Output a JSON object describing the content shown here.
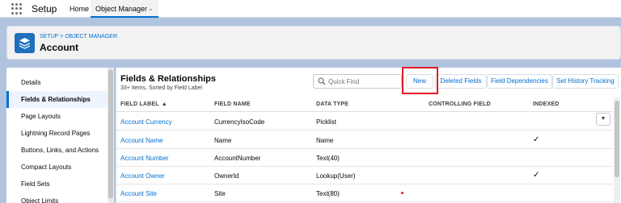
{
  "app": {
    "name": "Setup"
  },
  "nav": {
    "home": "Home",
    "object_manager": "Object Manager"
  },
  "header": {
    "breadcrumb": "SETUP > OBJECT MANAGER",
    "title": "Account"
  },
  "sidebar": {
    "items": [
      {
        "label": "Details",
        "active": false
      },
      {
        "label": "Fields & Relationships",
        "active": true
      },
      {
        "label": "Page Layouts",
        "active": false
      },
      {
        "label": "Lightning Record Pages",
        "active": false
      },
      {
        "label": "Buttons, Links, and Actions",
        "active": false
      },
      {
        "label": "Compact Layouts",
        "active": false
      },
      {
        "label": "Field Sets",
        "active": false
      },
      {
        "label": "Object Limits",
        "active": false
      }
    ]
  },
  "section": {
    "title": "Fields & Relationships",
    "subtitle": "33+ Items, Sorted by Field Label",
    "search_placeholder": "Quick Find",
    "buttons": {
      "new": "New",
      "deleted": "Deleted Fields",
      "dependencies": "Field Dependencies",
      "history": "Set History Tracking"
    }
  },
  "table": {
    "headers": {
      "label": "FIELD LABEL",
      "name": "FIELD NAME",
      "type": "DATA TYPE",
      "controlling": "CONTROLLING FIELD",
      "indexed": "INDEXED"
    },
    "sort_indicator": "▲",
    "rows": [
      {
        "label": "Account Currency",
        "name": "CurrencyIsoCode",
        "type": "Picklist",
        "indexed": ""
      },
      {
        "label": "Account Name",
        "name": "Name",
        "type": "Name",
        "indexed": "✓"
      },
      {
        "label": "Account Number",
        "name": "AccountNumber",
        "type": "Text(40)",
        "indexed": ""
      },
      {
        "label": "Account Owner",
        "name": "OwnerId",
        "type": "Lookup(User)",
        "indexed": "✓"
      },
      {
        "label": "Account Site",
        "name": "Site",
        "type": "Text(80)",
        "indexed": ""
      }
    ],
    "row_menu_icon": "▼"
  },
  "colors": {
    "accent": "#0070d2",
    "highlight": "#e41a24",
    "brand_icon": "#1f6fbc",
    "background": "#b0c4df"
  }
}
